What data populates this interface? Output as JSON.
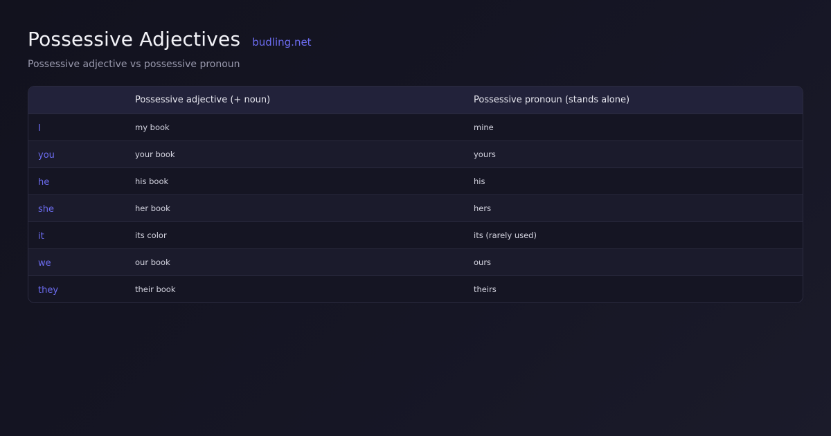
{
  "title": "Possessive Adjectives",
  "brand": "budling.net",
  "subtitle": "Possessive adjective vs possessive pronoun",
  "table": {
    "headers": [
      "",
      "Possessive adjective (+ noun)",
      "Possessive pronoun (stands alone)"
    ],
    "rows": [
      {
        "pronoun": "I",
        "adjective": "my book",
        "possessive": "mine"
      },
      {
        "pronoun": "you",
        "adjective": "your book",
        "possessive": "yours"
      },
      {
        "pronoun": "he",
        "adjective": "his book",
        "possessive": "his"
      },
      {
        "pronoun": "she",
        "adjective": "her book",
        "possessive": "hers"
      },
      {
        "pronoun": "it",
        "adjective": "its color",
        "possessive": "its (rarely used)"
      },
      {
        "pronoun": "we",
        "adjective": "our book",
        "possessive": "ours"
      },
      {
        "pronoun": "they",
        "adjective": "their book",
        "possessive": "theirs"
      }
    ]
  },
  "colors": {
    "accent": "#6c6cf0",
    "background": "#14141f",
    "header_row": "#22223a"
  }
}
